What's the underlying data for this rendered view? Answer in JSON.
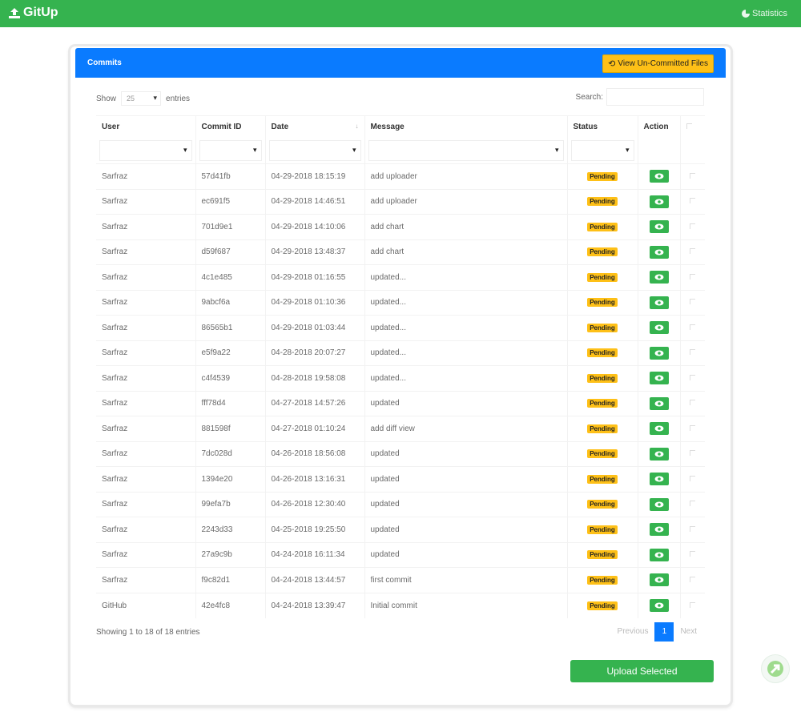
{
  "app": {
    "title": "GitUp",
    "statistics_label": "Statistics"
  },
  "card": {
    "title": "Commits",
    "view_button": "View Un-Committed Files"
  },
  "controls": {
    "show_label": "Show",
    "page_length": "25",
    "entries_label": "entries",
    "search_label": "Search:"
  },
  "columns": [
    "User",
    "Commit ID",
    "Date",
    "Message",
    "Status",
    "Action"
  ],
  "rows": [
    {
      "user": "Sarfraz",
      "id": "57d41fb",
      "date": "04-29-2018 18:15:19",
      "message": "add uploader",
      "status": "Pending"
    },
    {
      "user": "Sarfraz",
      "id": "ec691f5",
      "date": "04-29-2018 14:46:51",
      "message": "add uploader",
      "status": "Pending"
    },
    {
      "user": "Sarfraz",
      "id": "701d9e1",
      "date": "04-29-2018 14:10:06",
      "message": "add chart",
      "status": "Pending"
    },
    {
      "user": "Sarfraz",
      "id": "d59f687",
      "date": "04-29-2018 13:48:37",
      "message": "add chart",
      "status": "Pending"
    },
    {
      "user": "Sarfraz",
      "id": "4c1e485",
      "date": "04-29-2018 01:16:55",
      "message": "updated...",
      "status": "Pending"
    },
    {
      "user": "Sarfraz",
      "id": "9abcf6a",
      "date": "04-29-2018 01:10:36",
      "message": "updated...",
      "status": "Pending"
    },
    {
      "user": "Sarfraz",
      "id": "86565b1",
      "date": "04-29-2018 01:03:44",
      "message": "updated...",
      "status": "Pending"
    },
    {
      "user": "Sarfraz",
      "id": "e5f9a22",
      "date": "04-28-2018 20:07:27",
      "message": "updated...",
      "status": "Pending"
    },
    {
      "user": "Sarfraz",
      "id": "c4f4539",
      "date": "04-28-2018 19:58:08",
      "message": "updated...",
      "status": "Pending"
    },
    {
      "user": "Sarfraz",
      "id": "fff78d4",
      "date": "04-27-2018 14:57:26",
      "message": "updated",
      "status": "Pending"
    },
    {
      "user": "Sarfraz",
      "id": "881598f",
      "date": "04-27-2018 01:10:24",
      "message": "add diff view",
      "status": "Pending"
    },
    {
      "user": "Sarfraz",
      "id": "7dc028d",
      "date": "04-26-2018 18:56:08",
      "message": "updated",
      "status": "Pending"
    },
    {
      "user": "Sarfraz",
      "id": "1394e20",
      "date": "04-26-2018 13:16:31",
      "message": "updated",
      "status": "Pending"
    },
    {
      "user": "Sarfraz",
      "id": "99efa7b",
      "date": "04-26-2018 12:30:40",
      "message": "updated",
      "status": "Pending"
    },
    {
      "user": "Sarfraz",
      "id": "2243d33",
      "date": "04-25-2018 19:25:50",
      "message": "updated",
      "status": "Pending"
    },
    {
      "user": "Sarfraz",
      "id": "27a9c9b",
      "date": "04-24-2018 16:11:34",
      "message": "updated",
      "status": "Pending"
    },
    {
      "user": "Sarfraz",
      "id": "f9c82d1",
      "date": "04-24-2018 13:44:57",
      "message": "first commit",
      "status": "Pending"
    },
    {
      "user": "GitHub",
      "id": "42e4fc8",
      "date": "04-24-2018 13:39:47",
      "message": "Initial commit",
      "status": "Pending"
    }
  ],
  "footer": {
    "info": "Showing 1 to 18 of 18 entries",
    "previous": "Previous",
    "page": "1",
    "next": "Next",
    "upload_button": "Upload Selected"
  },
  "colors": {
    "brand_green": "#35b34f",
    "header_blue": "#0a7bff",
    "badge_yellow": "#fec017"
  },
  "icons": {
    "brand": "upload-icon",
    "stats": "pie-chart-icon",
    "view": "history-icon",
    "action": "eye-icon",
    "float": "arrow-icon"
  }
}
